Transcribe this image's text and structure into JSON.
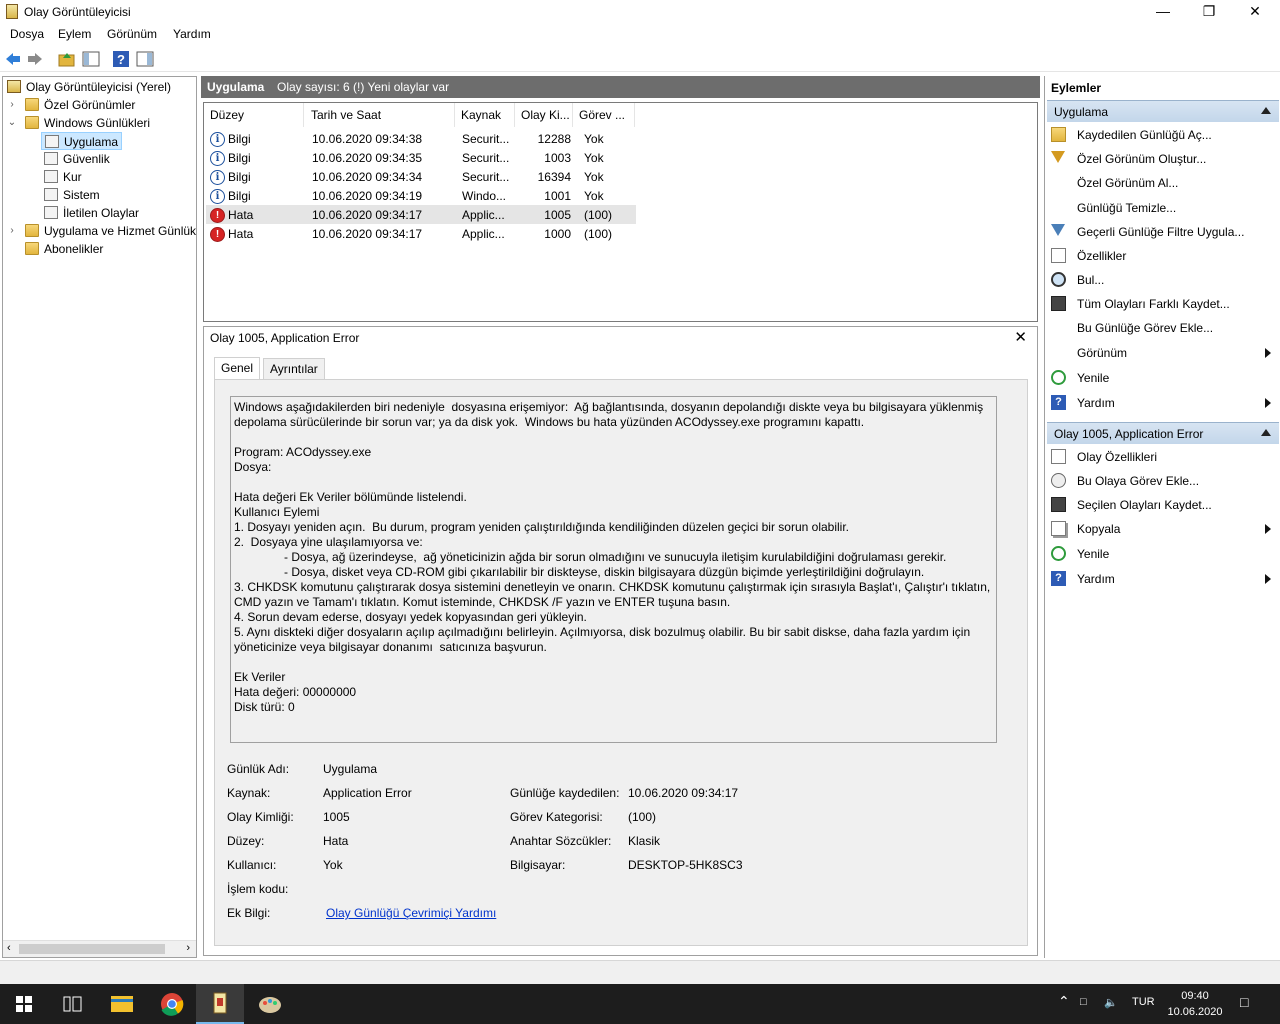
{
  "window": {
    "title": "Olay Görüntüleyicisi"
  },
  "menu": [
    "Dosya",
    "Eylem",
    "Görünüm",
    "Yardım"
  ],
  "tree": {
    "root": "Olay Görüntüleyicisi (Yerel)",
    "custom_views": "Özel Görünümler",
    "windows_logs": "Windows Günlükleri",
    "logs": [
      "Uygulama",
      "Güvenlik",
      "Kur",
      "Sistem",
      "İletilen Olaylar"
    ],
    "app_service_logs": "Uygulama ve Hizmet Günlük",
    "subscriptions": "Abonelikler"
  },
  "center_header": {
    "name": "Uygulama",
    "info": "Olay sayısı: 6 (!) Yeni olaylar var"
  },
  "event_columns": [
    "Düzey",
    "Tarih ve Saat",
    "Kaynak",
    "Olay Ki...",
    "Görev ..."
  ],
  "events": [
    {
      "level": "Bilgi",
      "level_type": "info",
      "date": "10.06.2020 09:34:38",
      "source": "Securit...",
      "id": "12288",
      "task": "Yok"
    },
    {
      "level": "Bilgi",
      "level_type": "info",
      "date": "10.06.2020 09:34:35",
      "source": "Securit...",
      "id": "1003",
      "task": "Yok"
    },
    {
      "level": "Bilgi",
      "level_type": "info",
      "date": "10.06.2020 09:34:34",
      "source": "Securit...",
      "id": "16394",
      "task": "Yok"
    },
    {
      "level": "Bilgi",
      "level_type": "info",
      "date": "10.06.2020 09:34:19",
      "source": "Windo...",
      "id": "1001",
      "task": "Yok"
    },
    {
      "level": "Hata",
      "level_type": "error",
      "date": "10.06.2020 09:34:17",
      "source": "Applic...",
      "id": "1005",
      "task": "(100)"
    },
    {
      "level": "Hata",
      "level_type": "error",
      "date": "10.06.2020 09:34:17",
      "source": "Applic...",
      "id": "1000",
      "task": "(100)"
    }
  ],
  "detail": {
    "title": "Olay 1005, Application Error",
    "tabs": [
      "Genel",
      "Ayrıntılar"
    ],
    "description": "Windows aşağıdakilerden biri nedeniyle  dosyasına erişemiyor:  Ağ bağlantısında, dosyanın depolandığı diskte veya bu bilgisayara yüklenmiş\ndepolama sürücülerinde bir sorun var; ya da disk yok.  Windows bu hata yüzünden ACOdyssey.exe programını kapattı.\n\nProgram: ACOdyssey.exe\nDosya: \n\nHata değeri Ek Veriler bölümünde listelendi.\nKullanıcı Eylemi\n1. Dosyayı yeniden açın.  Bu durum, program yeniden çalıştırıldığında kendiliğinden düzelen geçici bir sorun olabilir.\n2.  Dosyaya yine ulaşılamıyorsa ve:\n               - Dosya, ağ üzerindeyse,  ağ yöneticinizin ağda bir sorun olmadığını ve sunucuyla iletişim kurulabildiğini doğrulaması gerekir.\n               - Dosya, disket veya CD-ROM gibi çıkarılabilir bir diskteyse, diskin bilgisayara düzgün biçimde yerleştirildiğini doğrulayın.\n3. CHKDSK komutunu çalıştırarak dosya sistemini denetleyin ve onarın. CHKDSK komutunu çalıştırmak için sırasıyla Başlat'ı, Çalıştır'ı tıklatın,\nCMD yazın ve Tamam'ı tıklatın. Komut isteminde, CHKDSK /F yazın ve ENTER tuşuna basın.\n4. Sorun devam ederse, dosyayı yedek kopyasından geri yükleyin.\n5. Aynı diskteki diğer dosyaların açılıp açılmadığını belirleyin. Açılmıyorsa, disk bozulmuş olabilir. Bu bir sabit diskse, daha fazla yardım için\nyöneticinize veya bilgisayar donanımı  satıcınıza başvurun.\n\nEk Veriler\nHata değeri: 00000000\nDisk türü: 0",
    "props": {
      "log_name_label": "Günlük Adı:",
      "log_name": "Uygulama",
      "source_label": "Kaynak:",
      "source": "Application Error",
      "logged_label": "Günlüğe kaydedilen:",
      "logged": "10.06.2020 09:34:17",
      "event_id_label": "Olay Kimliği:",
      "event_id": "1005",
      "task_cat_label": "Görev Kategorisi:",
      "task_cat": "(100)",
      "level_label": "Düzey:",
      "level": "Hata",
      "keywords_label": "Anahtar Sözcükler:",
      "keywords": "Klasik",
      "user_label": "Kullanıcı:",
      "user": "Yok",
      "computer_label": "Bilgisayar:",
      "computer": "DESKTOP-5HK8SC3",
      "opcode_label": "İşlem kodu:",
      "more_info_label": "Ek Bilgi:",
      "more_info_link": "Olay Günlüğü Çevrimiçi Yardımı"
    }
  },
  "actions": {
    "header": "Eylemler",
    "section1": {
      "title": "Uygulama",
      "items": [
        {
          "label": "Kaydedilen Günlüğü Aç...",
          "icon": "open-log-icon"
        },
        {
          "label": "Özel Görünüm Oluştur...",
          "icon": "filter-icon"
        },
        {
          "label": "Özel Görünüm Al...",
          "icon": ""
        },
        {
          "label": "Günlüğü Temizle...",
          "icon": ""
        },
        {
          "label": "Geçerli Günlüğe Filtre Uygula...",
          "icon": "filter-icon"
        },
        {
          "label": "Özellikler",
          "icon": "properties-icon"
        },
        {
          "label": "Bul...",
          "icon": "find-icon"
        },
        {
          "label": "Tüm Olayları Farklı Kaydet...",
          "icon": "save-icon"
        },
        {
          "label": "Bu Günlüğe Görev Ekle...",
          "icon": ""
        },
        {
          "label": "Görünüm",
          "icon": "",
          "submenu": true
        },
        {
          "label": "Yenile",
          "icon": "refresh-icon"
        },
        {
          "label": "Yardım",
          "icon": "help-icon",
          "submenu": true
        }
      ]
    },
    "section2": {
      "title": "Olay 1005, Application Error",
      "items": [
        {
          "label": "Olay Özellikleri",
          "icon": "properties-icon"
        },
        {
          "label": "Bu Olaya Görev Ekle...",
          "icon": "task-icon"
        },
        {
          "label": "Seçilen Olayları Kaydet...",
          "icon": "save-icon"
        },
        {
          "label": "Kopyala",
          "icon": "copy-icon",
          "submenu": true
        },
        {
          "label": "Yenile",
          "icon": "refresh-icon"
        },
        {
          "label": "Yardım",
          "icon": "help-icon",
          "submenu": true
        }
      ]
    }
  },
  "taskbar": {
    "lang": "TUR",
    "time": "09:40",
    "date": "10.06.2020"
  }
}
